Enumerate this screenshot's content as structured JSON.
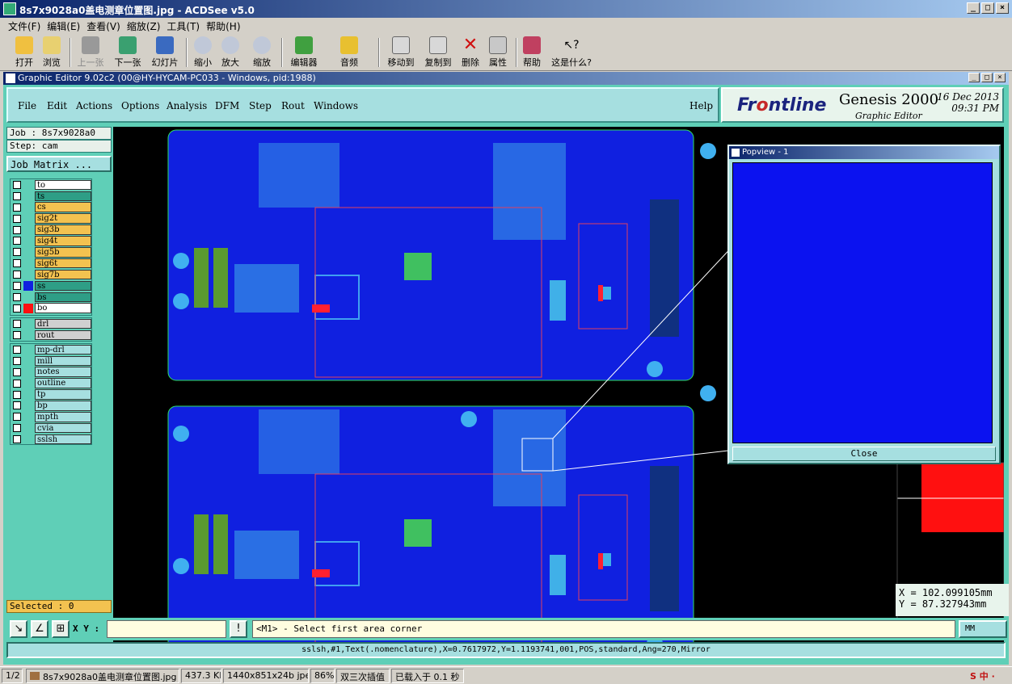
{
  "acdsee": {
    "title": "8s7x9028a0盖电测章位置图.jpg - ACDSee v5.0",
    "menu": [
      "文件(F)",
      "编辑(E)",
      "查看(V)",
      "缩放(Z)",
      "工具(T)",
      "帮助(H)"
    ],
    "toolbar": {
      "open": "打开",
      "browse": "浏览",
      "prev": "上一张",
      "next": "下一张",
      "slideshow": "幻灯片",
      "zoom_out": "缩小",
      "zoom_in": "放大",
      "zoom": "缩放",
      "editor": "编辑器",
      "audio": "音频",
      "move_to": "移动到",
      "copy_to": "复制到",
      "delete": "删除",
      "properties": "属性",
      "help": "帮助",
      "whats_this": "这是什么?"
    }
  },
  "genesis": {
    "title": "Graphic Editor 9.02c2 (00@HY-HYCAM-PC033 - Windows, pid:1988)",
    "menu": [
      "File",
      "Edit",
      "Actions",
      "Options",
      "Analysis",
      "DFM",
      "Step",
      "Rout",
      "Windows"
    ],
    "help": "Help",
    "logo_front": "Fr",
    "logo_o": "o",
    "logo_rest": "ntline",
    "product": "Genesis 2000",
    "product_sub": "Graphic Editor",
    "date": "16 Dec 2013",
    "time": "09:31 PM",
    "job": "Job : 8s7x9028a0",
    "step": "Step: cam",
    "job_matrix": "Job Matrix ...",
    "layers_board": [
      {
        "name": "to",
        "bg": "#ffffff"
      },
      {
        "name": "ts",
        "bg": "#2e9e86"
      },
      {
        "name": "cs",
        "bg": "#f3c250"
      },
      {
        "name": "sig2t",
        "bg": "#f3c250"
      },
      {
        "name": "sig3b",
        "bg": "#f3c250"
      },
      {
        "name": "sig4t",
        "bg": "#f3c250"
      },
      {
        "name": "sig5b",
        "bg": "#f3c250"
      },
      {
        "name": "sig6t",
        "bg": "#f3c250"
      },
      {
        "name": "sig7b",
        "bg": "#f3c250"
      },
      {
        "name": "ss",
        "bg": "#2e9e86"
      },
      {
        "name": "bs",
        "bg": "#2e9e86"
      },
      {
        "name": "bo",
        "bg": "#ffffff"
      }
    ],
    "layers_drill": [
      {
        "name": "drl",
        "bg": "#d0d0d0"
      },
      {
        "name": "rout",
        "bg": "#d0d0d0"
      }
    ],
    "layers_misc": [
      {
        "name": "mp-drl",
        "bg": "#a6dfe0"
      },
      {
        "name": "mill",
        "bg": "#a6dfe0"
      },
      {
        "name": "notes",
        "bg": "#a6dfe0"
      },
      {
        "name": "outline",
        "bg": "#a6dfe0"
      },
      {
        "name": "tp",
        "bg": "#a6dfe0"
      },
      {
        "name": "bp",
        "bg": "#a6dfe0"
      },
      {
        "name": "mpth",
        "bg": "#a6dfe0"
      },
      {
        "name": "cvia",
        "bg": "#a6dfe0"
      },
      {
        "name": "sslsh",
        "bg": "#a6dfe0"
      }
    ],
    "selected": "Selected : 0",
    "popview_title": "Popview - 1",
    "close": "Close",
    "coord_x": "X = 102.099105mm",
    "coord_y": "Y = 87.327943mm",
    "xy_label": "X Y :",
    "prompt": "<M1> - Select first area corner",
    "units": "MM",
    "info": "sslsh,#1,Text(.nomenclature),X=0.7617972,Y=1.1193741,001,POS,standard,Ang=270,Mirror"
  },
  "statusbar": {
    "index": "1/2",
    "filename": "8s7x9028a0盖电测章位置图.jpg",
    "size": "437.3 KB",
    "dims": "1440x851x24b jpeg",
    "zoom": "86%",
    "interp": "双三次插值",
    "load": "已载入于 0.1 秒"
  },
  "colors": {
    "board_blue": "#1020e0",
    "panel_teal": "#5fcfb7",
    "highlight_red": "#ff1010"
  }
}
